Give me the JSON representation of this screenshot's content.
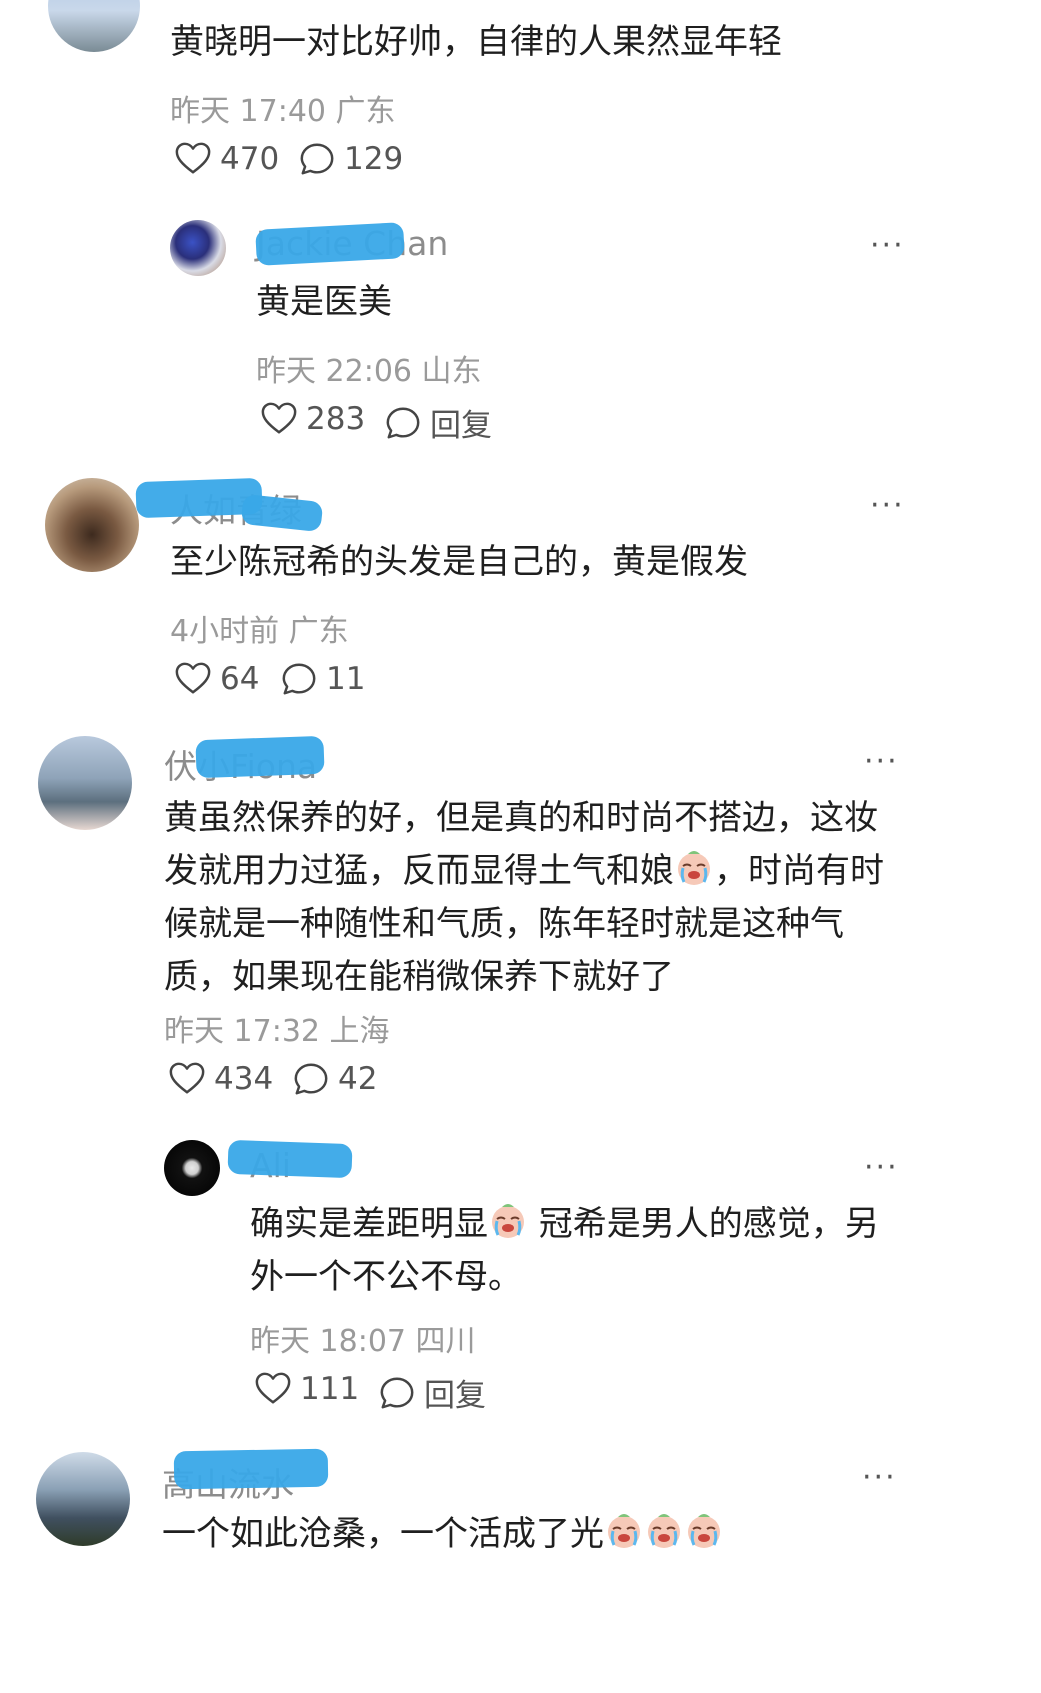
{
  "comments": [
    {
      "text": "黄晓明一对比好帅，自律的人果然显年轻",
      "time": "昨天 17:40",
      "location": "广东",
      "likes": "470",
      "replies": "129"
    },
    {
      "username": "Jackie Chan",
      "text": "黄是医美",
      "time": "昨天 22:06",
      "location": "山东",
      "likes": "283",
      "reply_label": "回复"
    },
    {
      "username": "人如青绿",
      "text": "至少陈冠希的头发是自己的，黄是假发",
      "time": "4小时前",
      "location": "广东",
      "likes": "64",
      "replies": "11"
    },
    {
      "username": "伏小Fiona",
      "text_lines": [
        "黄虽然保养的好，但是真的和时尚不搭边，这妆",
        "发就用力过猛，反而显得土气和娘",
        "，时尚有时",
        "候就是一种随性和气质，陈年轻时就是这种气",
        "质，如果现在能稍微保养下就好了"
      ],
      "time": "昨天 17:32",
      "location": "上海",
      "likes": "434",
      "replies": "42"
    },
    {
      "username": "Ali",
      "text_lines": [
        "确实是差距明显",
        " 冠希是男人的感觉，另",
        "外一个不公不母。"
      ],
      "time": "昨天 18:07",
      "location": "四川",
      "likes": "111",
      "reply_label": "回复"
    },
    {
      "username": "高山流水",
      "text": "一个如此沧桑，一个活成了光"
    }
  ],
  "icons": {
    "like": "heart-outline-icon",
    "comment": "speech-bubble-icon",
    "more": "ellipsis-icon",
    "emoji": "crying-face-emoji"
  },
  "colors": {
    "redaction": "#39a8e8",
    "meta": "#9a9a9a",
    "text": "#1f1f1f"
  }
}
